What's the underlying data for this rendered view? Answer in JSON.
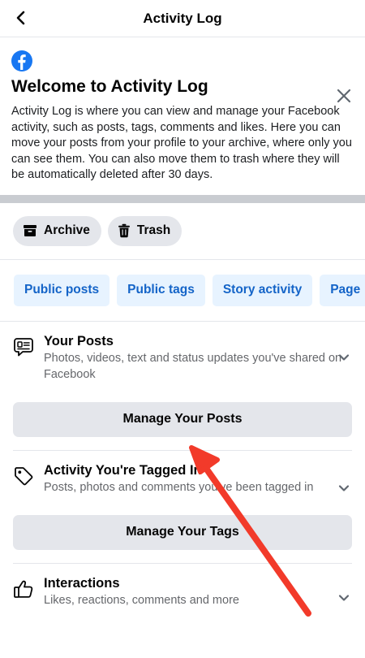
{
  "header": {
    "title": "Activity Log"
  },
  "welcome": {
    "title": "Welcome to Activity Log",
    "body": "Activity Log is where you can view and manage your Facebook activity, such as posts, tags, comments and likes. Here you can move your posts from your profile to your archive, where only you can see them. You can also move them to trash where they will be automatically deleted after 30 days."
  },
  "actions": {
    "archive": "Archive",
    "trash": "Trash"
  },
  "tabs": [
    "Public posts",
    "Public tags",
    "Story activity",
    "Page"
  ],
  "sections": [
    {
      "title": "Your Posts",
      "desc": "Photos, videos, text and status updates you've shared on Facebook",
      "button": "Manage Your Posts"
    },
    {
      "title": "Activity You're Tagged In",
      "desc": "Posts, photos and comments you've been tagged in",
      "button": "Manage Your Tags"
    },
    {
      "title": "Interactions",
      "desc": "Likes, reactions, comments and more"
    }
  ],
  "colors": {
    "brand": "#1877f2",
    "tab_bg": "#e7f3ff",
    "tab_text": "#1464c8",
    "annotation_arrow": "#f23a2a"
  },
  "icons": [
    "back-arrow-icon",
    "facebook-logo-icon",
    "close-icon",
    "archive-box-icon",
    "trash-can-icon",
    "post-bubble-icon",
    "tag-icon",
    "thumbs-up-icon",
    "chevron-down-icon"
  ]
}
